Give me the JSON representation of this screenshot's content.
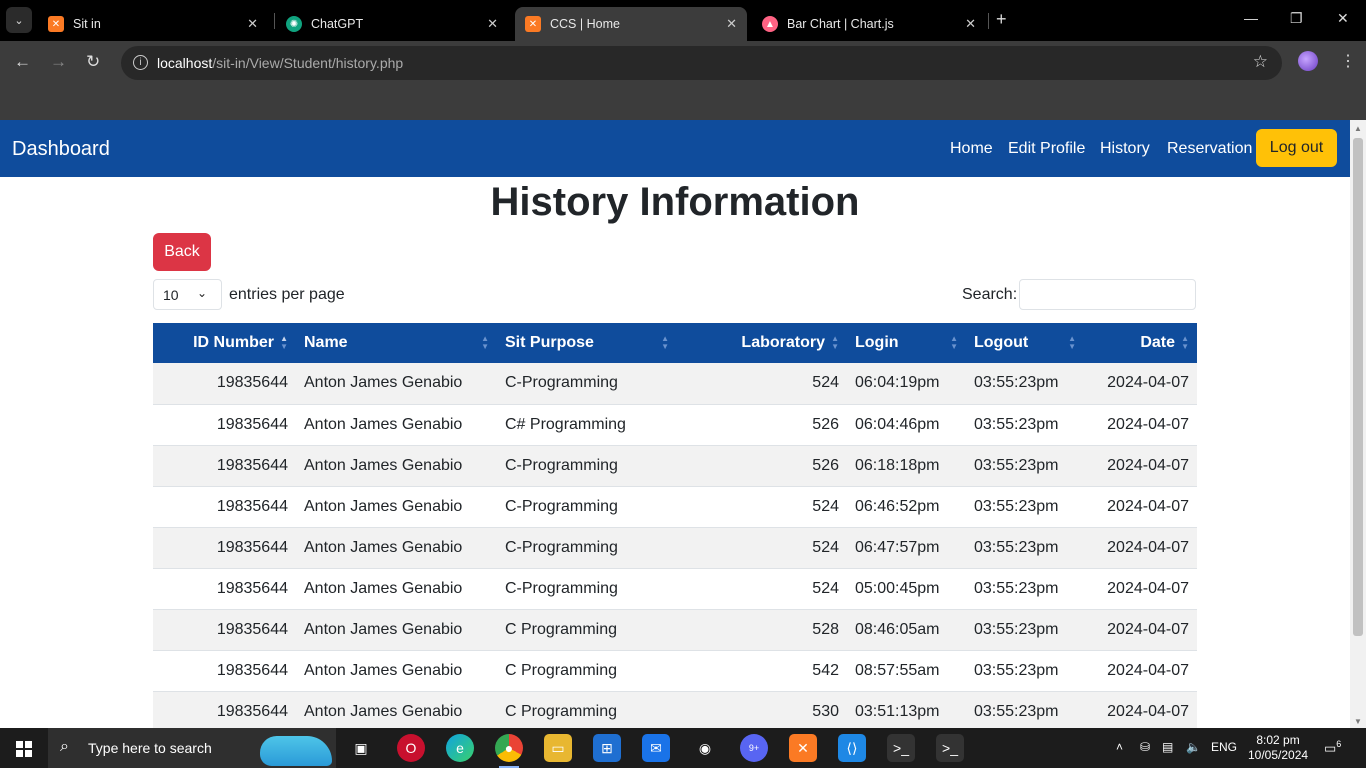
{
  "browser": {
    "tabs": [
      {
        "title": "Sit in",
        "icon": "xampp-icon"
      },
      {
        "title": "ChatGPT",
        "icon": "chatgpt-icon"
      },
      {
        "title": "CCS | Home",
        "icon": "xampp-icon",
        "active": true
      },
      {
        "title": "Bar Chart | Chart.js",
        "icon": "chartjs-icon"
      }
    ],
    "url_host": "localhost",
    "url_path": "/sit-in/View/Student/history.php"
  },
  "navbar": {
    "brand": "Dashboard",
    "links": [
      "Home",
      "Edit Profile",
      "History",
      "Reservation"
    ],
    "logout": "Log out"
  },
  "page": {
    "title": "History Information",
    "back_label": "Back",
    "entries_value": "10",
    "entries_label": "entries per page",
    "search_label": "Search:"
  },
  "table": {
    "headers": [
      "ID Number",
      "Name",
      "Sit Purpose",
      "Laboratory",
      "Login",
      "Logout",
      "Date"
    ],
    "rows": [
      [
        "19835644",
        "Anton James Genabio",
        "C-Programming",
        "524",
        "06:04:19pm",
        "03:55:23pm",
        "2024-04-07"
      ],
      [
        "19835644",
        "Anton James Genabio",
        "C# Programming",
        "526",
        "06:04:46pm",
        "03:55:23pm",
        "2024-04-07"
      ],
      [
        "19835644",
        "Anton James Genabio",
        "C-Programming",
        "526",
        "06:18:18pm",
        "03:55:23pm",
        "2024-04-07"
      ],
      [
        "19835644",
        "Anton James Genabio",
        "C-Programming",
        "524",
        "06:46:52pm",
        "03:55:23pm",
        "2024-04-07"
      ],
      [
        "19835644",
        "Anton James Genabio",
        "C-Programming",
        "524",
        "06:47:57pm",
        "03:55:23pm",
        "2024-04-07"
      ],
      [
        "19835644",
        "Anton James Genabio",
        "C-Programming",
        "524",
        "05:00:45pm",
        "03:55:23pm",
        "2024-04-07"
      ],
      [
        "19835644",
        "Anton James Genabio",
        "C Programming",
        "528",
        "08:46:05am",
        "03:55:23pm",
        "2024-04-07"
      ],
      [
        "19835644",
        "Anton James Genabio",
        "C Programming",
        "542",
        "08:57:55am",
        "03:55:23pm",
        "2024-04-07"
      ],
      [
        "19835644",
        "Anton James Genabio",
        "C Programming",
        "530",
        "03:51:13pm",
        "03:55:23pm",
        "2024-04-07"
      ]
    ]
  },
  "taskbar": {
    "search_placeholder": "Type here to search",
    "language": "ENG",
    "time": "8:02 pm",
    "date": "10/05/2024",
    "notifications": "6",
    "discord_badge": "9+"
  },
  "colors": {
    "navbar": "#0f4c9c",
    "logout": "#ffc107",
    "back": "#dc3545"
  }
}
